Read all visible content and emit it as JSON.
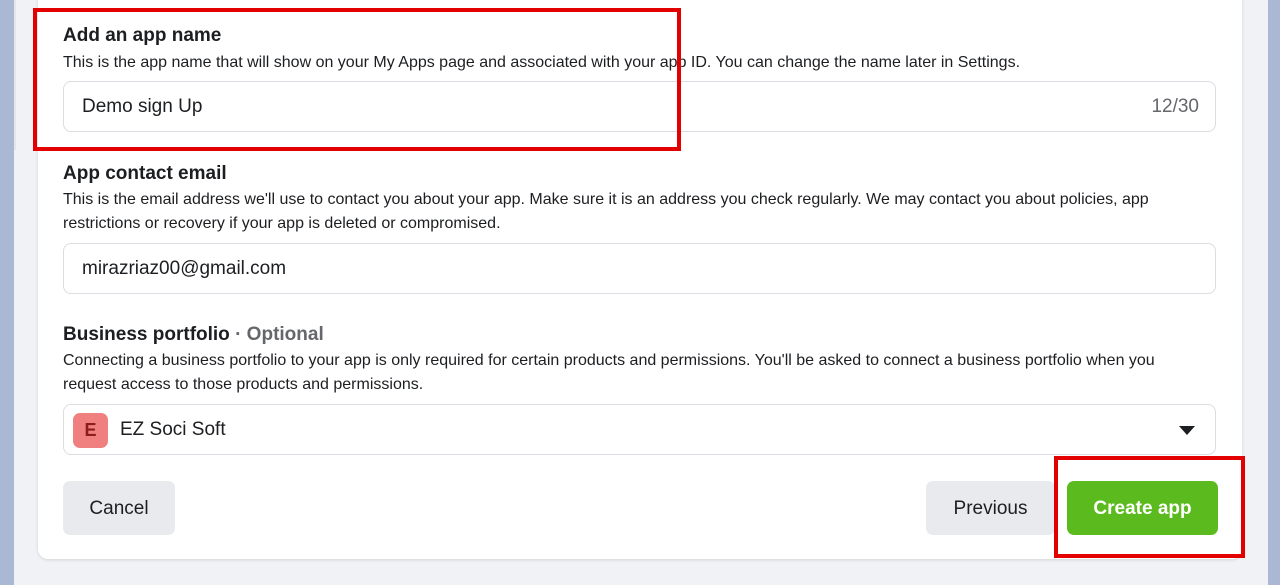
{
  "app_name_section": {
    "label": "Add an app name",
    "description": "This is the app name that will show on your My Apps page and associated with your app ID. You can change the name later in Settings.",
    "value": "Demo sign Up",
    "counter": "12/30"
  },
  "contact_email_section": {
    "label": "App contact email",
    "description": "This is the email address we'll use to contact you about your app. Make sure it is an address you check regularly. We may contact you about policies, app restrictions or recovery if your app is deleted or compromised.",
    "value": "mirazriaz00@gmail.com"
  },
  "business_portfolio_section": {
    "label": "Business portfolio",
    "optional_label": "· Optional",
    "description": "Connecting a business portfolio to your app is only required for certain products and permissions. You'll be asked to connect a business portfolio when you request access to those products and permissions.",
    "selected": {
      "initial": "E",
      "name": "EZ Soci Soft"
    },
    "dropdown_icon": "caret-down-icon"
  },
  "footer": {
    "cancel_label": "Cancel",
    "previous_label": "Previous",
    "create_label": "Create app"
  },
  "colors": {
    "create_button": "#5bbb1e",
    "highlight_box": "#e30000",
    "avatar_bg": "#f08080"
  }
}
